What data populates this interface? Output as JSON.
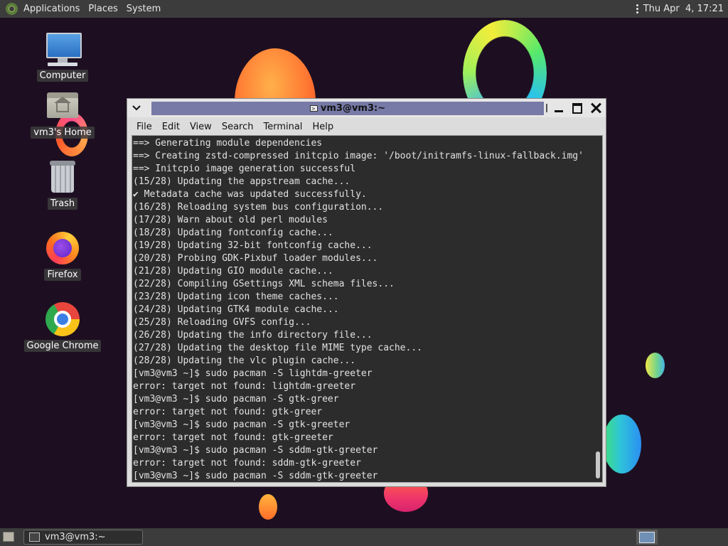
{
  "top_panel": {
    "menus": [
      "Applications",
      "Places",
      "System"
    ],
    "clock": "Thu Apr  4, 17:21"
  },
  "desktop_icons": [
    {
      "label": "Computer",
      "icon": "computer-icon"
    },
    {
      "label": "vm3's Home",
      "icon": "home-folder-icon"
    },
    {
      "label": "Trash",
      "icon": "trash-icon"
    },
    {
      "label": "Firefox",
      "icon": "firefox-icon"
    },
    {
      "label": "Google Chrome",
      "icon": "chrome-icon"
    }
  ],
  "terminal": {
    "title": "vm3@vm3:~",
    "menu": [
      "File",
      "Edit",
      "View",
      "Search",
      "Terminal",
      "Help"
    ],
    "lines": [
      "==> Generating module dependencies",
      "==> Creating zstd-compressed initcpio image: '/boot/initramfs-linux-fallback.img'",
      "==> Initcpio image generation successful",
      "(15/28) Updating the appstream cache...",
      "✔ Metadata cache was updated successfully.",
      "(16/28) Reloading system bus configuration...",
      "(17/28) Warn about old perl modules",
      "(18/28) Updating fontconfig cache...",
      "(19/28) Updating 32-bit fontconfig cache...",
      "(20/28) Probing GDK-Pixbuf loader modules...",
      "(21/28) Updating GIO module cache...",
      "(22/28) Compiling GSettings XML schema files...",
      "(23/28) Updating icon theme caches...",
      "(24/28) Updating GTK4 module cache...",
      "(25/28) Reloading GVFS config...",
      "(26/28) Updating the info directory file...",
      "(27/28) Updating the desktop file MIME type cache...",
      "(28/28) Updating the vlc plugin cache...",
      "[vm3@vm3 ~]$ sudo pacman -S lightdm-greeter",
      "error: target not found: lightdm-greeter",
      "[vm3@vm3 ~]$ sudo pacman -S gtk-greer",
      "error: target not found: gtk-greer",
      "[vm3@vm3 ~]$ sudo pacman -S gtk-greeter",
      "error: target not found: gtk-greeter",
      "[vm3@vm3 ~]$ sudo pacman -S sddm-gtk-greeter",
      "error: target not found: sddm-gtk-greeter",
      "[vm3@vm3 ~]$ sudo pacman -S sddm-gtk-greeter"
    ]
  },
  "bottom_panel": {
    "tasks": [
      {
        "label": "vm3@vm3:~",
        "icon": "terminal-icon"
      }
    ]
  },
  "colors": {
    "desktop_bg": "#1d0f21",
    "panel_bg": "#3c3c3c",
    "terminal_bg": "#2c2c2c",
    "title_strip": "#777aa6"
  }
}
